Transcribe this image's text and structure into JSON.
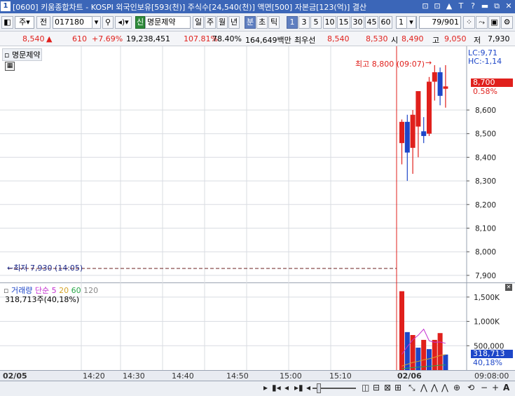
{
  "titlebar": {
    "number": "1",
    "text": "[0600] 키움종합차트 - KOSPI 외국인보유[593(천)] 주식수[24,540(천)] 액면[500] 자본금[123(억)] 결산",
    "controls": [
      "⊡",
      "⊡",
      "🗗",
      "▲",
      "T",
      "?",
      "▬",
      "⧉",
      "✕"
    ]
  },
  "toolbar": {
    "type_label": "주",
    "prev_label": "전",
    "code_value": "017180",
    "search_icon": "search-icon",
    "sound_icon": "speaker-icon",
    "new_badge": "신",
    "stock_name": "명문제약",
    "period_buttons": [
      "일",
      "주",
      "월",
      "년",
      "분",
      "초",
      "틱"
    ],
    "period_selected": "분",
    "interval_buttons": [
      "1",
      "3",
      "5",
      "10",
      "15",
      "30",
      "45",
      "60"
    ],
    "interval_selected": "1",
    "interval_value": "1",
    "count_value": "79",
    "count_total": "/901"
  },
  "info": {
    "price": "8,540",
    "change_arrow": "▲",
    "change": "610",
    "change_pct": "+7.69%",
    "volume": "19,238,451",
    "vol_ratio": "107.81%",
    "turnover": "78.40%",
    "amount": "164,649백만",
    "best_label": "최우선",
    "ask": "8,540",
    "bid": "8,530",
    "open_label": "시",
    "open": "8,490",
    "high_label": "고",
    "high": "9,050",
    "low_label": "저",
    "low": "7,930"
  },
  "main_chart": {
    "legend": "명문제약",
    "lc_label": "LC:9,71",
    "hc_label": "HC:-1,14",
    "max_annotation": "최고 8,800 (09:07)",
    "min_annotation": "최저 7,930 (14:05)",
    "current_price": "8,700",
    "current_pct": "0.58%"
  },
  "chart_data": {
    "type": "candlestick",
    "y_ticks": [
      "8,600",
      "8,500",
      "8,400",
      "8,300",
      "8,200",
      "8,100",
      "8,000",
      "7,900"
    ],
    "ylim": [
      7870,
      8870
    ],
    "candles": [
      {
        "o": 8460,
        "h": 8560,
        "l": 8370,
        "c": 8550
      },
      {
        "o": 8550,
        "h": 8580,
        "l": 8300,
        "c": 8420
      },
      {
        "o": 8440,
        "h": 8600,
        "l": 8330,
        "c": 8580
      },
      {
        "o": 8530,
        "h": 8680,
        "l": 8400,
        "c": 8680
      },
      {
        "o": 8510,
        "h": 8570,
        "l": 8460,
        "c": 8490
      },
      {
        "o": 8500,
        "h": 8740,
        "l": 8490,
        "c": 8720
      },
      {
        "o": 8720,
        "h": 8790,
        "l": 8640,
        "c": 8760
      },
      {
        "o": 8760,
        "h": 8780,
        "l": 8620,
        "c": 8660
      },
      {
        "o": 8690,
        "h": 8790,
        "l": 8610,
        "c": 8700
      }
    ],
    "volume": {
      "legend_label": "거래량",
      "ma_label": "단순",
      "ma_periods": [
        "5",
        "20",
        "60",
        "120"
      ],
      "ma_colors": [
        "#c42fd0",
        "#d6a52a",
        "#2aa84a",
        "#888888"
      ],
      "summary": "318,713주(40,18%)",
      "y_ticks": [
        "1,500K",
        "1,000K",
        "500,000"
      ],
      "ylim": [
        0,
        1800000
      ],
      "current_value": "318,713",
      "current_pct": "40,18%",
      "bars": [
        1620000,
        780000,
        720000,
        460000,
        620000,
        430000,
        620000,
        760000,
        318713
      ],
      "bar_colors": [
        "red",
        "blue",
        "red",
        "blue",
        "red",
        "blue",
        "red",
        "red",
        "blue"
      ]
    },
    "x_ticks": [
      "02/05",
      "14:20",
      "14:30",
      "14:40",
      "14:50",
      "15:00",
      "15:10",
      "02/06",
      "09:08:00"
    ]
  },
  "bottom": {
    "controls": [
      "▶",
      "◀",
      "◀▮",
      "▮▶",
      "▶▶"
    ]
  },
  "colors": {
    "up": "#e0201c",
    "down": "#1d46c8",
    "grid": "#d9dce2",
    "titlebar": "#3b66b8"
  }
}
